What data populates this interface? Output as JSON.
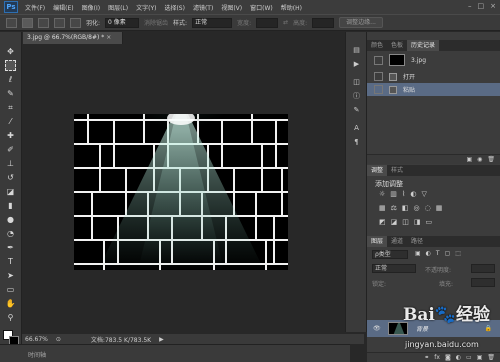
{
  "app": {
    "logo": "Ps"
  },
  "menu": [
    "文件(F)",
    "编辑(E)",
    "图像(I)",
    "图层(L)",
    "文字(Y)",
    "选择(S)",
    "滤镜(T)",
    "视图(V)",
    "窗口(W)",
    "帮助(H)"
  ],
  "window_buttons": [
    "–",
    "□",
    "×"
  ],
  "options": {
    "feather_label": "羽化:",
    "feather_value": "0 像素",
    "antialias_label": "消除锯齿",
    "style_label": "样式:",
    "style_value": "正常",
    "width_label": "宽度:",
    "height_label": "高度:",
    "refine_edge": "调整边缘..."
  },
  "document": {
    "tab_title": "3.jpg @ 66.7%(RGB/8#) *",
    "close": "×",
    "zoom": "66.67%",
    "doc_info": "文档:783.5 K/783.5K",
    "timeline": "时间轴"
  },
  "history_panel": {
    "tabs": [
      "颜色",
      "色板",
      "历史记录"
    ],
    "snapshot": "3.jpg",
    "items": [
      "打开",
      "粘贴"
    ]
  },
  "adjust_panel": {
    "tabs": [
      "调整",
      "样式"
    ],
    "title": "添加调整"
  },
  "layers_panel": {
    "tabs": [
      "图层",
      "通道",
      "路径"
    ],
    "kind_label": "ρ类型",
    "blend_mode": "正常",
    "opacity_label": "不透明度:",
    "lock_label": "锁定:",
    "fill_label": "填充:",
    "layer_name": "背景",
    "lock_icon": "🔒"
  },
  "watermark": {
    "logo": "Bai🐾经验",
    "url": "jingyan.baidu.com"
  },
  "colors": {
    "selected": "#5a6b85",
    "accent": "#4fa3f7"
  }
}
